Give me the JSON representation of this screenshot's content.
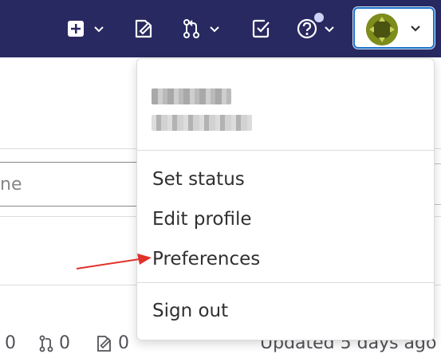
{
  "navbar": {
    "create_icon": "plus-square-icon",
    "issues_icon": "issues-icon",
    "merge_requests_icon": "merge-request-icon",
    "todos_icon": "todo-checkbox-icon",
    "help_icon": "question-circle-icon",
    "user_avatar_icon": "user-avatar",
    "chevron_icon": "chevron-down-icon"
  },
  "colors": {
    "navbar_bg": "#292961",
    "focus_ring": "#1f75cb",
    "arrow": "#e0322a"
  },
  "background": {
    "search_partial_text": "ne",
    "stats": {
      "forks": "0",
      "merge_requests": "0",
      "issues": "0"
    },
    "updated_text": "Updated 5 days ago"
  },
  "dropdown": {
    "items": [
      {
        "label": "Set status"
      },
      {
        "label": "Edit profile"
      },
      {
        "label": "Preferences"
      },
      {
        "label": "Sign out"
      }
    ]
  }
}
